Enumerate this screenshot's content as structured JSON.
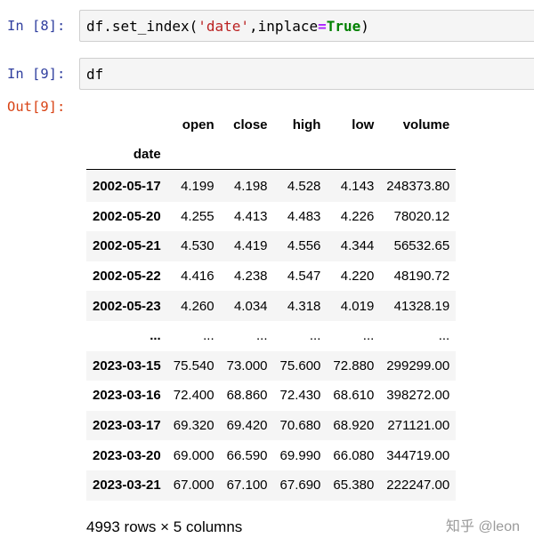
{
  "cells": {
    "in8": {
      "prompt": "In [8]:",
      "code_parts": [
        "df.set_index(",
        "'date'",
        ",inplace",
        "=",
        "True",
        ")"
      ]
    },
    "in9": {
      "prompt": "In [9]:",
      "code": "df"
    },
    "out9": {
      "prompt": "Out[9]:"
    }
  },
  "dataframe": {
    "columns": [
      "open",
      "close",
      "high",
      "low",
      "volume"
    ],
    "index_name": "date",
    "rows": [
      [
        "2002-05-17",
        "4.199",
        "4.198",
        "4.528",
        "4.143",
        "248373.80"
      ],
      [
        "2002-05-20",
        "4.255",
        "4.413",
        "4.483",
        "4.226",
        "78020.12"
      ],
      [
        "2002-05-21",
        "4.530",
        "4.419",
        "4.556",
        "4.344",
        "56532.65"
      ],
      [
        "2002-05-22",
        "4.416",
        "4.238",
        "4.547",
        "4.220",
        "48190.72"
      ],
      [
        "2002-05-23",
        "4.260",
        "4.034",
        "4.318",
        "4.019",
        "41328.19"
      ],
      [
        "...",
        "...",
        "...",
        "...",
        "...",
        "..."
      ],
      [
        "2023-03-15",
        "75.540",
        "73.000",
        "75.600",
        "72.880",
        "299299.00"
      ],
      [
        "2023-03-16",
        "72.400",
        "68.860",
        "72.430",
        "68.610",
        "398272.00"
      ],
      [
        "2023-03-17",
        "69.320",
        "69.420",
        "70.680",
        "68.920",
        "271121.00"
      ],
      [
        "2023-03-20",
        "69.000",
        "66.590",
        "69.990",
        "66.080",
        "344719.00"
      ],
      [
        "2023-03-21",
        "67.000",
        "67.100",
        "67.690",
        "65.380",
        "222247.00"
      ]
    ],
    "shape_text": "4993 rows × 5 columns"
  },
  "watermark": "知乎 @leon",
  "colors": {
    "in_prompt": "#303f9f",
    "out_prompt": "#d84315",
    "string": "#ba2121",
    "operator": "#aa22ff",
    "keyword": "#008000"
  }
}
